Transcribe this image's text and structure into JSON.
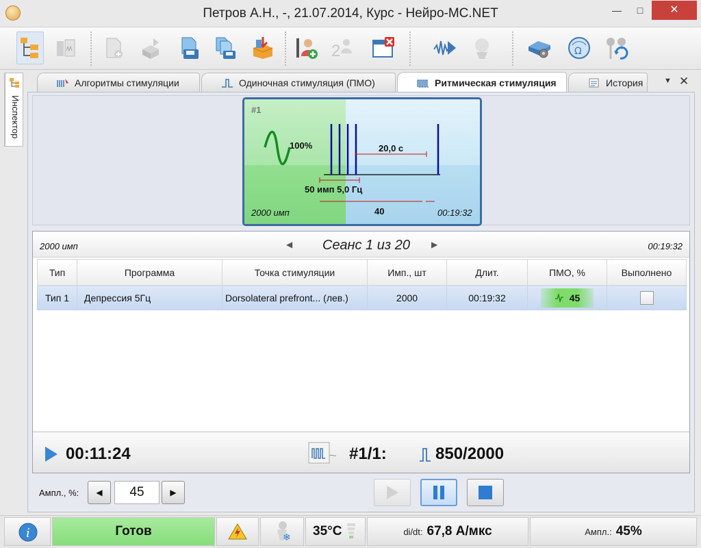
{
  "window": {
    "title": "Петров А.Н., -, 21.07.2014, Курс - Нейро-МС.NET",
    "minimize_icon": "minimize-icon",
    "maximize_icon": "maximize-icon",
    "close_icon": "close-icon"
  },
  "toolbar": {
    "icons": [
      "tree-icon",
      "device-icon",
      "new-doc-icon",
      "export-icon",
      "save-icon",
      "save-all-icon",
      "import-icon",
      "new-patient-icon",
      "patients-icon",
      "close-window-icon",
      "signal-play-icon",
      "coil-icon",
      "settings-device-icon",
      "impedance-icon",
      "sync-icon"
    ]
  },
  "inspector": {
    "label": "Инспектор"
  },
  "tabs": [
    {
      "label": "Алгоритмы стимуляции",
      "icon": "algorithm-icon",
      "active": false
    },
    {
      "label": "Одиночная стимуляция (ПМО)",
      "icon": "single-pulse-icon",
      "active": false
    },
    {
      "label": "Ритмическая стимуляция",
      "icon": "rhythm-icon",
      "active": true
    },
    {
      "label": "История",
      "icon": "history-icon",
      "active": false
    }
  ],
  "tab_controls": {
    "pin_icon": "tab-menu-icon",
    "close_icon": "tab-close-icon"
  },
  "card": {
    "number": "#1",
    "intensity": "100%",
    "interval": "20,0 с",
    "train": "50 имп 5,0 Гц",
    "repeats": "40",
    "total_pulses": "2000 имп",
    "duration": "00:19:32",
    "accent_color": "#0a0aa8"
  },
  "session": {
    "pulses": "2000 имп",
    "title": "Сеанс 1 из 20",
    "duration": "00:19:32",
    "columns": [
      "Тип",
      "Программа",
      "Точка стимуляции",
      "Имп., шт",
      "Длит.",
      "ПМО, %",
      "Выполнено"
    ],
    "rows": [
      {
        "type": "Тип 1",
        "program": "Депрессия 5Гц",
        "point": "Dorsolateral prefront...  (лев.)",
        "pulses": "2000",
        "duration": "00:19:32",
        "pmo": "45",
        "done": false
      }
    ],
    "footer": {
      "elapsed": "00:11:24",
      "progress": "#1/1:",
      "count": "850/2000"
    }
  },
  "controls": {
    "ampl_label": "Ампл., %:",
    "ampl_value": "45"
  },
  "status": {
    "ready": "Готов",
    "temp": "35°C",
    "didt_label": "di/dt:",
    "didt_value": "67,8 А/мкс",
    "ampl_label": "Ампл.:",
    "ampl_value": "45%",
    "ready_color": "#86dd7b"
  }
}
